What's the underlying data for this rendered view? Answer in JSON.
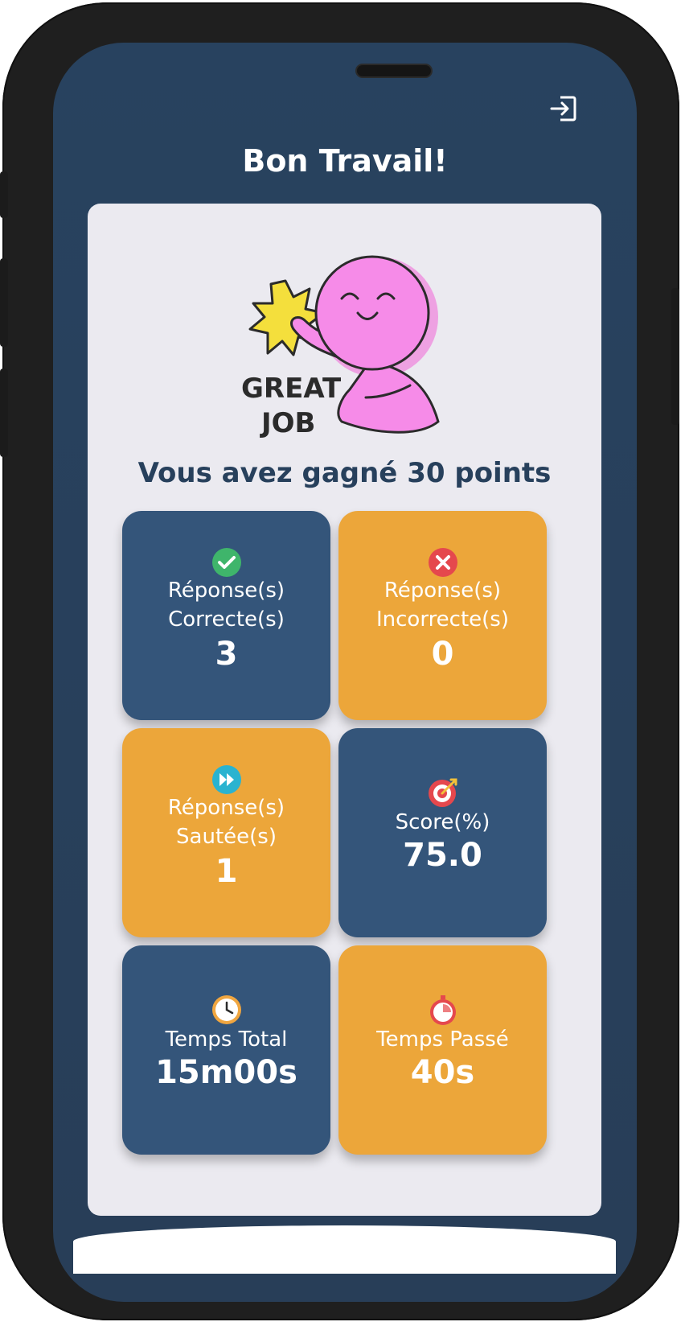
{
  "header": {
    "title": "Bon Travail!",
    "logout_icon": "logout-icon"
  },
  "result": {
    "illustration_icon": "great-job-character-illustration",
    "illustration_text_line1": "GREAT",
    "illustration_text_line2": "JOB",
    "points_message": "Vous avez gagné 30 points"
  },
  "stats": [
    {
      "icon": "check-circle-icon",
      "label_line1": "Réponse(s)",
      "label_line2": "Correcte(s)",
      "value": "3",
      "color": "#34557a"
    },
    {
      "icon": "x-circle-icon",
      "label_line1": "Réponse(s)",
      "label_line2": "Incorrecte(s)",
      "value": "0",
      "color": "#eca63a"
    },
    {
      "icon": "fast-forward-icon",
      "label_line1": "Réponse(s)",
      "label_line2": "Sautée(s)",
      "value": "1",
      "color": "#eca63a"
    },
    {
      "icon": "target-icon",
      "label_line1": "Score(%)",
      "label_line2": "",
      "value": "75.0",
      "color": "#34557a"
    },
    {
      "icon": "clock-icon",
      "label_line1": "Temps Total",
      "label_line2": "",
      "value": "15m00s",
      "color": "#34557a"
    },
    {
      "icon": "stopwatch-icon",
      "label_line1": "Temps Passé",
      "label_line2": "",
      "value": "40s",
      "color": "#eca63a"
    }
  ],
  "colors": {
    "background": "#28425f",
    "card": "#ebeaf0",
    "tile_blue": "#34557a",
    "tile_orange": "#eca63a",
    "text_dark": "#27405c"
  }
}
